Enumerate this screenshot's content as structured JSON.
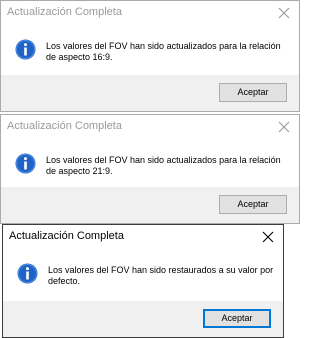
{
  "icons": {
    "info": "info-icon",
    "close": "close-icon"
  },
  "colors": {
    "info_icon": "#1f63c6",
    "default_button_border": "#0078d7",
    "footer_bg": "#f0f0f0"
  },
  "dialogs": [
    {
      "title": "Actualización Completa",
      "message": "Los valores del FOV han sido actualizados para la relación de aspecto 16:9.",
      "button_label": "Aceptar"
    },
    {
      "title": "Actualización Completa",
      "message": "Los valores del FOV han sido actualizados para la relación de aspecto 21:9.",
      "button_label": "Aceptar"
    },
    {
      "title": "Actualización Completa",
      "message": "Los valores del FOV han sido restaurados a su valor por defecto.",
      "button_label": "Aceptar"
    }
  ]
}
